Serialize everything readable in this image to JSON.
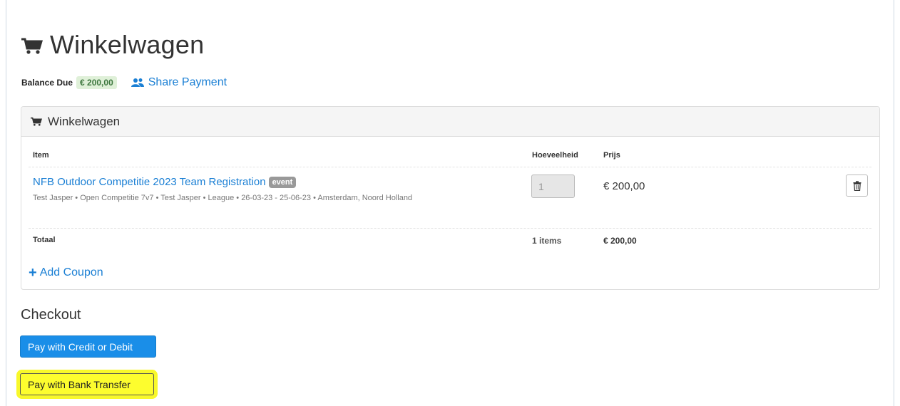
{
  "page": {
    "title": "Winkelwagen",
    "balance_label": "Balance Due",
    "balance_amount": "€ 200,00",
    "share_payment": "Share Payment"
  },
  "panel": {
    "heading": "Winkelwagen",
    "columns": {
      "item": "Item",
      "quantity": "Hoeveelheid",
      "price": "Prijs"
    },
    "items": [
      {
        "title": "NFB Outdoor Competitie 2023 Team Registration",
        "badge": "event",
        "description": "Test Jasper • Open Competitie 7v7 • Test Jasper • League • 26-03-23 - 25-06-23 • Amsterdam, Noord Holland",
        "quantity": "1",
        "price": "€ 200,00"
      }
    ],
    "total": {
      "label": "Totaal",
      "count": "1 items",
      "amount": "€ 200,00"
    },
    "add_coupon": "Add Coupon"
  },
  "checkout": {
    "title": "Checkout",
    "pay_card": "Pay with Credit or Debit",
    "pay_bank": "Pay with Bank Transfer"
  },
  "colors": {
    "link": "#1a7fd4",
    "primary_button": "#1a8ee8",
    "highlight": "#fdfd2e",
    "balance_badge_bg": "#dff0d8",
    "event_badge_bg": "#999999"
  },
  "icons": {
    "title": "shopping-cart-icon",
    "share": "users-icon",
    "remove": "trash-icon",
    "coupon": "plus-icon"
  }
}
